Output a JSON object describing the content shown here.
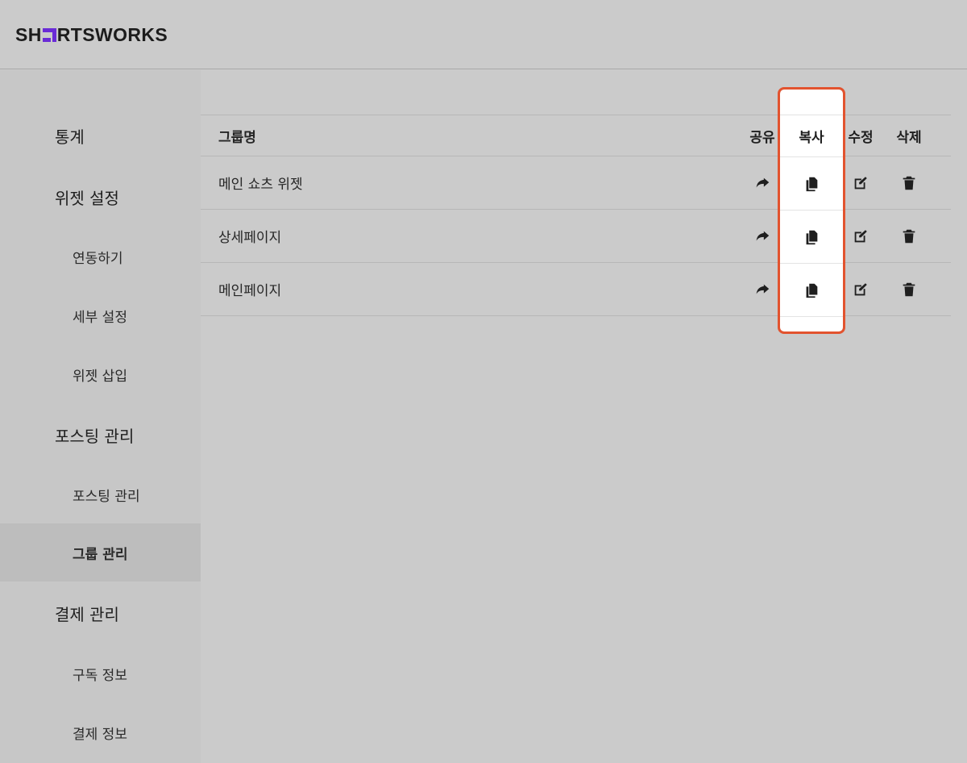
{
  "app": {
    "logo_prefix": "SH",
    "logo_suffix": "RTSWORKS"
  },
  "sidebar": {
    "items": [
      {
        "label": "통계",
        "level": 1
      },
      {
        "label": "위젯 설정",
        "level": 1
      },
      {
        "label": "연동하기",
        "level": 2
      },
      {
        "label": "세부 설정",
        "level": 2
      },
      {
        "label": "위젯 삽입",
        "level": 2
      },
      {
        "label": "포스팅 관리",
        "level": 1
      },
      {
        "label": "포스팅 관리",
        "level": 2
      },
      {
        "label": "그룹 관리",
        "level": 2,
        "active": true
      },
      {
        "label": "결제 관리",
        "level": 1
      },
      {
        "label": "구독 정보",
        "level": 2
      },
      {
        "label": "결제 정보",
        "level": 2
      }
    ]
  },
  "table": {
    "headers": {
      "name": "그룹명",
      "share": "공유",
      "copy": "복사",
      "edit": "수정",
      "delete": "삭제"
    },
    "rows": [
      {
        "name": "메인 쇼츠 위젯"
      },
      {
        "name": "상세페이지"
      },
      {
        "name": "메인페이지"
      }
    ],
    "icons": {
      "share": "share-arrow-icon",
      "copy": "copy-icon",
      "edit": "edit-icon",
      "delete": "trash-icon"
    }
  },
  "colors": {
    "accent_logo": "#6a2bd6",
    "highlight": "#e2532f"
  }
}
